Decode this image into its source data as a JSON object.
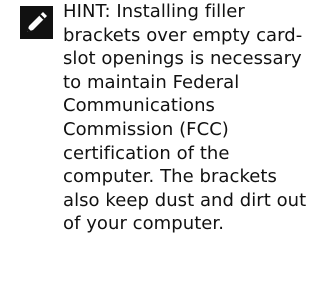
{
  "hint": {
    "icon": "pencil-icon",
    "text": "HINT: Installing filler\nbrackets over empty card-\nslot openings is necessary\nto maintain Federal\nCommunications\nCommission (FCC)\ncertification of the\ncomputer. The brackets\nalso keep dust and dirt out\nof your computer."
  }
}
